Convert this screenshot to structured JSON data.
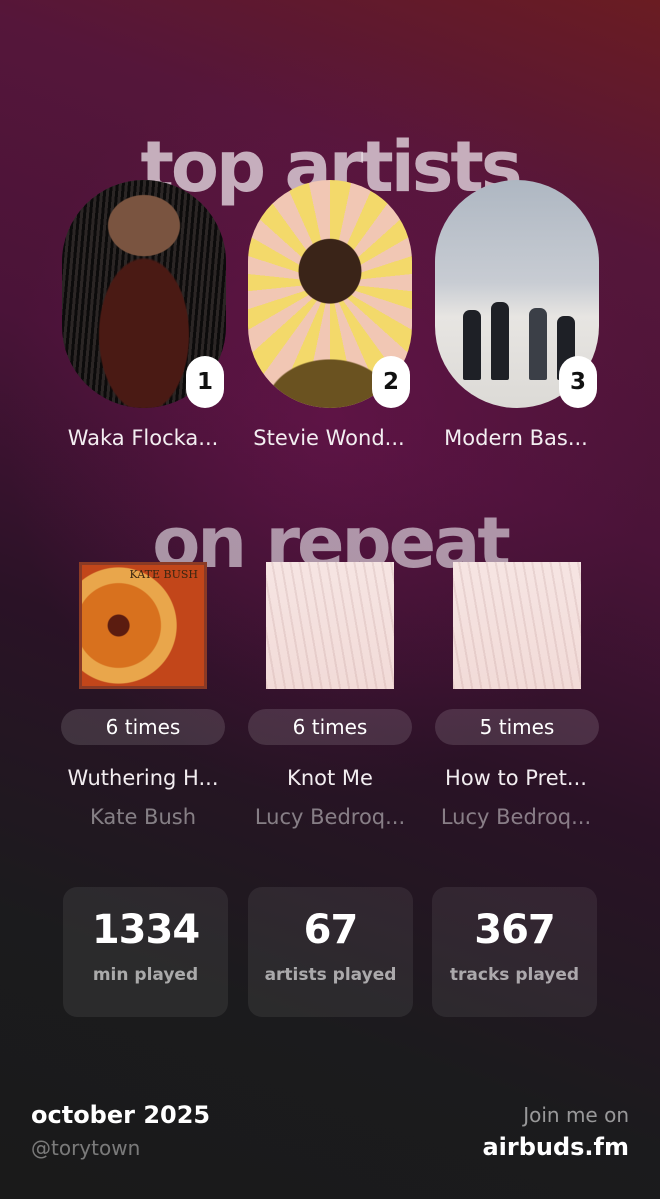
{
  "top_artists": {
    "title": "top artists",
    "items": [
      {
        "rank": "1",
        "name": "Waka Flocka..."
      },
      {
        "rank": "2",
        "name": "Stevie Wond..."
      },
      {
        "rank": "3",
        "name": "Modern Bas..."
      }
    ]
  },
  "on_repeat": {
    "title": "on repeat",
    "cover_text": "KATE BUSH",
    "items": [
      {
        "times": "6 times",
        "track": "Wuthering H...",
        "artist": "Kate Bush"
      },
      {
        "times": "6 times",
        "track": "Knot Me",
        "artist": "Lucy Bedroq..."
      },
      {
        "times": "5 times",
        "track": "How to Pret...",
        "artist": "Lucy Bedroq..."
      }
    ]
  },
  "stats": [
    {
      "value": "1334",
      "label": "min played"
    },
    {
      "value": "67",
      "label": "artists played"
    },
    {
      "value": "367",
      "label": "tracks played"
    }
  ],
  "footer": {
    "month": "october 2025",
    "handle": "@torytown",
    "join": "Join me on",
    "site": "airbuds.fm"
  }
}
